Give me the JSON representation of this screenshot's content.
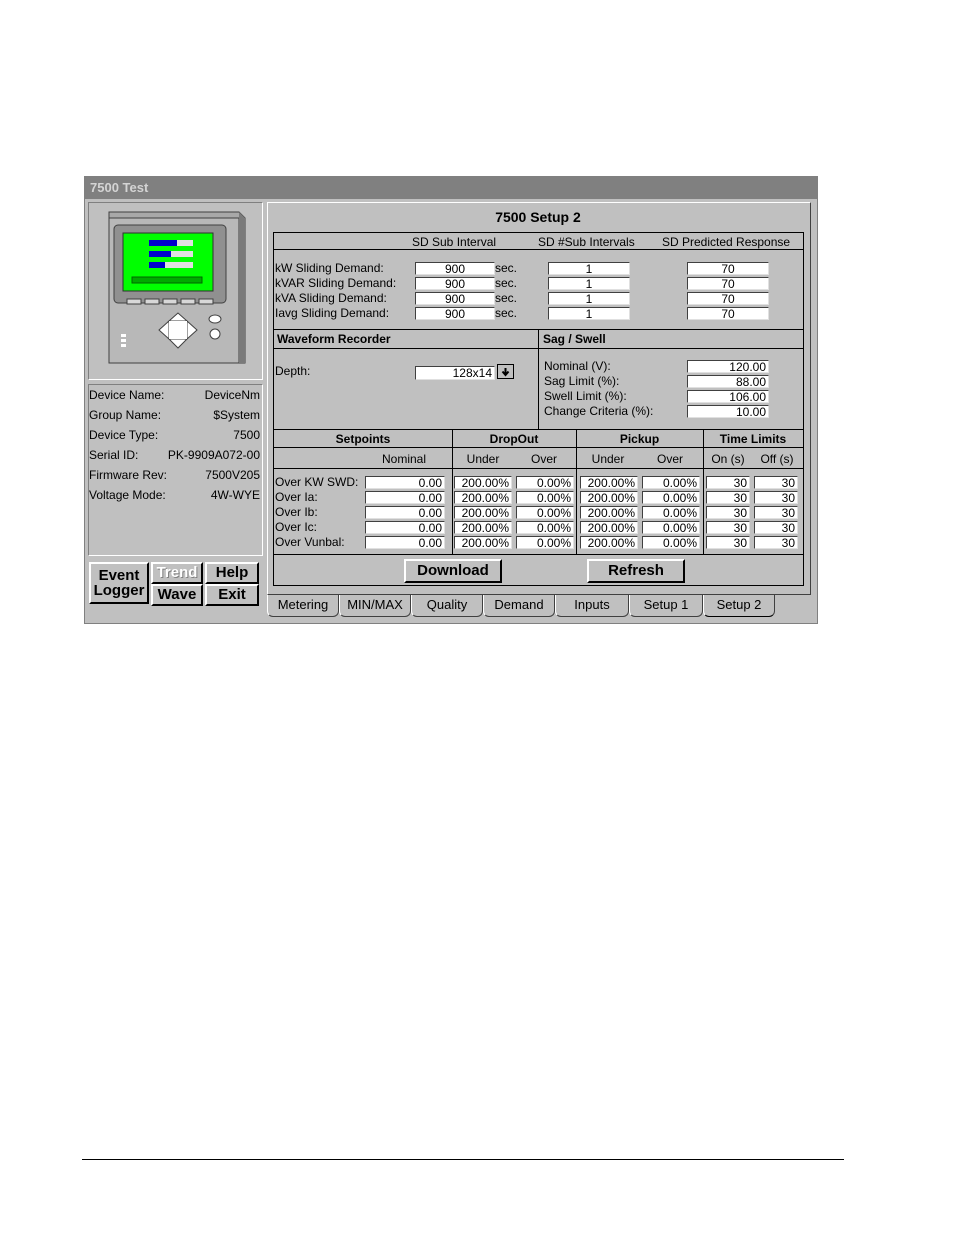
{
  "window": {
    "title": "7500 Test"
  },
  "panel": {
    "title": "7500 Setup 2"
  },
  "demand": {
    "col_interval": "SD Sub Interval",
    "col_subintervals": "SD #Sub Intervals",
    "col_predicted": "SD Predicted Response",
    "unit": "sec.",
    "rows": [
      {
        "label": "kW Sliding Demand:",
        "interval": "900",
        "subintervals": "1",
        "predicted": "70"
      },
      {
        "label": "kVAR Sliding Demand:",
        "interval": "900",
        "subintervals": "1",
        "predicted": "70"
      },
      {
        "label": "kVA Sliding Demand:",
        "interval": "900",
        "subintervals": "1",
        "predicted": "70"
      },
      {
        "label": "Iavg Sliding Demand:",
        "interval": "900",
        "subintervals": "1",
        "predicted": "70"
      }
    ]
  },
  "waveform": {
    "title": "Waveform Recorder",
    "depth_label": "Depth:",
    "depth_value": "128x14"
  },
  "sag": {
    "title": "Sag / Swell",
    "rows": [
      {
        "label": "Nominal (V):",
        "value": "120.00"
      },
      {
        "label": "Sag Limit (%):",
        "value": "88.00"
      },
      {
        "label": "Swell Limit (%):",
        "value": "106.00"
      },
      {
        "label": "Change Criteria (%):",
        "value": "10.00"
      }
    ]
  },
  "setpoints": {
    "h_setpoints": "Setpoints",
    "h_dropout": "DropOut",
    "h_pickup": "Pickup",
    "h_time": "Time Limits",
    "s_nominal": "Nominal",
    "s_drop_under": "Under",
    "s_drop_over": "Over",
    "s_pick_under": "Under",
    "s_pick_over": "Over",
    "s_on": "On (s)",
    "s_off": "Off (s)",
    "rows": [
      {
        "label": "Over KW SWD:",
        "nominal": "0.00",
        "du": "200.00%",
        "do": "0.00%",
        "pu": "200.00%",
        "po": "0.00%",
        "on": "30",
        "off": "30"
      },
      {
        "label": "Over Ia:",
        "nominal": "0.00",
        "du": "200.00%",
        "do": "0.00%",
        "pu": "200.00%",
        "po": "0.00%",
        "on": "30",
        "off": "30"
      },
      {
        "label": "Over Ib:",
        "nominal": "0.00",
        "du": "200.00%",
        "do": "0.00%",
        "pu": "200.00%",
        "po": "0.00%",
        "on": "30",
        "off": "30"
      },
      {
        "label": "Over Ic:",
        "nominal": "0.00",
        "du": "200.00%",
        "do": "0.00%",
        "pu": "200.00%",
        "po": "0.00%",
        "on": "30",
        "off": "30"
      },
      {
        "label": "Over Vunbal:",
        "nominal": "0.00",
        "du": "200.00%",
        "do": "0.00%",
        "pu": "200.00%",
        "po": "0.00%",
        "on": "30",
        "off": "30"
      }
    ]
  },
  "actions": {
    "download": "Download",
    "refresh": "Refresh"
  },
  "device": {
    "rows": [
      {
        "label": "Device Name:",
        "value": "DeviceNm"
      },
      {
        "label": "Group Name:",
        "value": "$System"
      },
      {
        "label": "Device Type:",
        "value": "7500"
      },
      {
        "label": "Serial ID:",
        "value": "PK-9909A072-00"
      },
      {
        "label": "Firmware Rev:",
        "value": "7500V205"
      },
      {
        "label": "Voltage Mode:",
        "value": "4W-WYE"
      }
    ]
  },
  "nav": {
    "event": "Event",
    "logger": "Logger",
    "trend": "Trend",
    "help": "Help",
    "wave": "Wave",
    "exit": "Exit"
  },
  "tabs": [
    "Metering",
    "MIN/MAX",
    "Quality",
    "Demand",
    "Inputs",
    "Setup 1",
    "Setup 2"
  ],
  "active_tab": "Setup 2",
  "colors": {
    "screen": "#00ff00",
    "bar": "#0000cc",
    "titlebar": "#808080"
  }
}
